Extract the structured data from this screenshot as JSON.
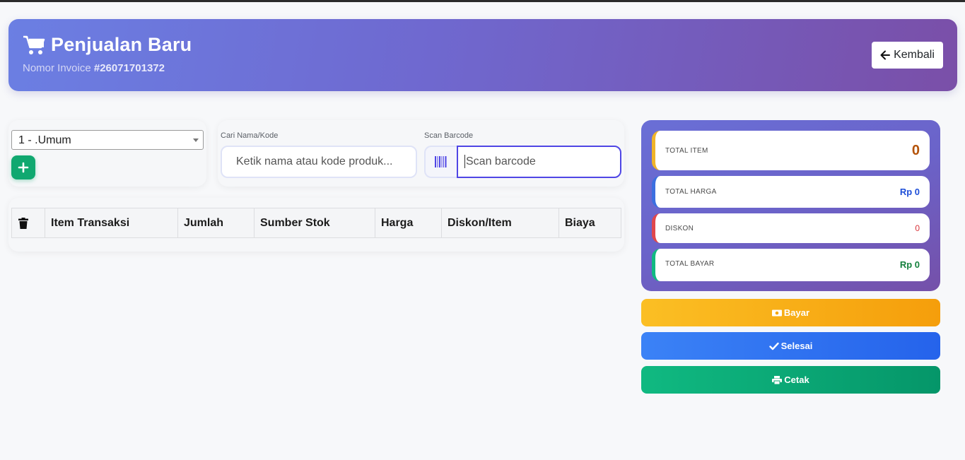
{
  "header": {
    "title": "Penjualan Baru",
    "invoice_label": "Nomor Invoice",
    "invoice_number": "#26071701372",
    "back_label": "Kembali"
  },
  "customer": {
    "selected": "1 - .Umum"
  },
  "search": {
    "name_label": "Cari Nama/Kode",
    "name_placeholder": "Ketik nama atau kode produk...",
    "barcode_label": "Scan Barcode",
    "barcode_placeholder": "Scan barcode"
  },
  "table": {
    "columns": [
      "Item Transaksi",
      "Jumlah",
      "Sumber Stok",
      "Harga",
      "Diskon/Item",
      "Biaya"
    ]
  },
  "summary": {
    "total_item_label": "TOTAL ITEM",
    "total_item_value": "0",
    "total_harga_label": "TOTAL HARGA",
    "total_harga_value": "Rp 0",
    "diskon_label": "DISKON",
    "diskon_value": "0",
    "total_bayar_label": "TOTAL BAYAR",
    "total_bayar_value": "Rp 0"
  },
  "actions": {
    "bayar": "Bayar",
    "selesai": "Selesai",
    "cetak": "Cetak"
  },
  "colors": {
    "header_gradient_start": "#6b7fe3",
    "header_gradient_end": "#7a4fa8",
    "add_button": "#10a870",
    "bayar": "#f59e0b",
    "selesai": "#2563eb",
    "cetak": "#059669"
  }
}
